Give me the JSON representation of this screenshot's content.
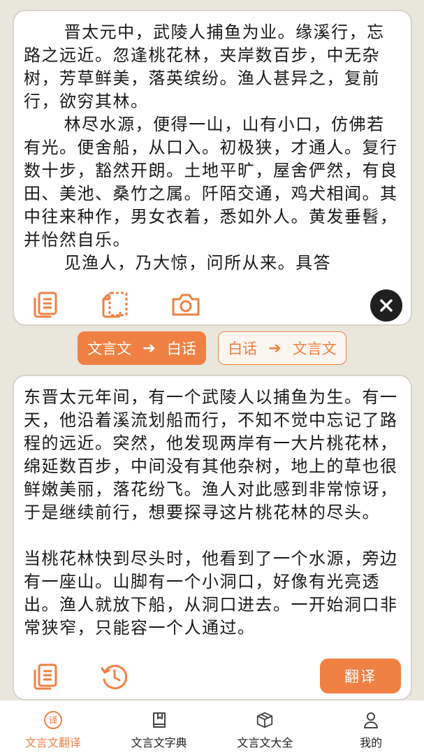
{
  "source": {
    "paragraphs": [
      "晋太元中，武陵人捕鱼为业。缘溪行，忘路之远近。忽逢桃花林，夹岸数百步，中无杂树，芳草鲜美，落英缤纷。渔人甚异之，复前行，欲穷其林。",
      "林尽水源，便得一山，山有小口，仿佛若有光。便舍船，从口入。初极狭，才通人。复行数十步，豁然开朗。土地平旷，屋舍俨然，有良田、美池、桑竹之属。阡陌交通，鸡犬相闻。其中往来种作，男女衣着，悉如外人。黄发垂髫，并怡然自乐。",
      "见渔人，乃大惊，问所从来。具答"
    ],
    "icons": [
      "copy-icon",
      "paste-icon",
      "camera-icon",
      "close-icon"
    ]
  },
  "direction": {
    "classic_to_modern": {
      "from": "文言文",
      "to": "白话"
    },
    "modern_to_classic": {
      "from": "白话",
      "to": "文言文"
    }
  },
  "result": {
    "paragraphs": [
      "东晋太元年间，有一个武陵人以捕鱼为生。有一天，他沿着溪流划船而行，不知不觉中忘记了路程的远近。突然，他发现两岸有一大片桃花林，绵延数百步，中间没有其他杂树，地上的草也很鲜嫩美丽，落花纷飞。渔人对此感到非常惊讶，于是继续前行，想要探寻这片桃花林的尽头。",
      "当桃花林快到尽头时，他看到了一个水源，旁边有一座山。山脚有一个小洞口，好像有光亮透出。渔人就放下船，从洞口进去。一开始洞口非常狭窄，只能容一个人通过。"
    ],
    "translate_label": "翻译",
    "icons": [
      "copy-icon",
      "history-icon"
    ]
  },
  "tabs": [
    {
      "label": "文言文翻译",
      "icon": "translate-icon",
      "active": true
    },
    {
      "label": "文言文字典",
      "icon": "book-icon",
      "active": false
    },
    {
      "label": "文言文大全",
      "icon": "cube-icon",
      "active": false
    },
    {
      "label": "我的",
      "icon": "user-icon",
      "active": false
    }
  ],
  "colors": {
    "accent": "#ef8043",
    "background": "#e9e6dc"
  }
}
